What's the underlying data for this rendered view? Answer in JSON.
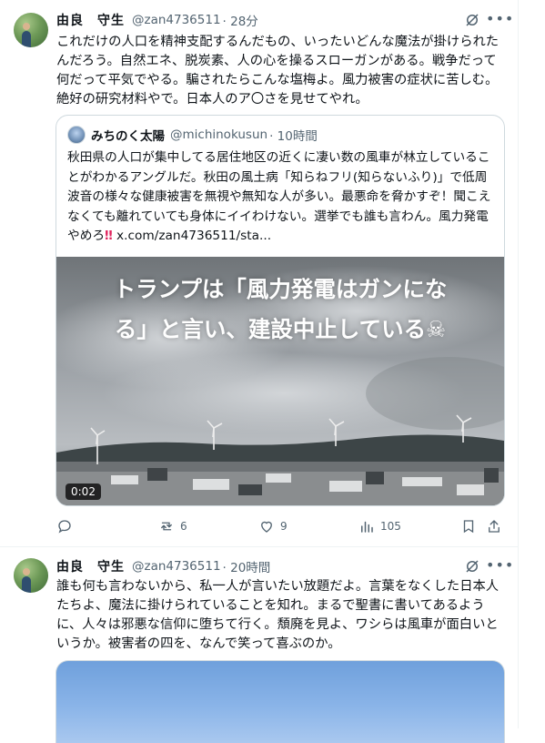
{
  "colors": {
    "text": "#0f1419",
    "secondary": "#536471",
    "border": "#cfd9de",
    "danger": "#e0245e"
  },
  "tweets": [
    {
      "author": "由良　守生",
      "handle": "@zan4736511",
      "time": "· 28分",
      "text": "これだけの人口を精神支配するんだもの、いったいどんな魔法が掛けられたんだろう。自然エネ、脱炭素、人の心を操るスローガンがある。戦争だって何だって平気でやる。騙されたらこんな塩梅よ。風力被害の症状に苦しむ。絶好の研究材料やで。日本人のア〇さを見せてやれ。",
      "quote": {
        "author": "みちのく太陽",
        "handle": "@michinokusun",
        "time": "· 10時間",
        "text": "秋田県の人口が集中してる居住地区の近くに凄い数の風車が林立していることがわかるアングルだ。秋田の風土病「知らねフリ(知らないふり)」で低周波音の様々な健康被害を無視や無知な人が多い。最悪命を脅かすぞ！聞こえなくても離れていても身体にイイわけない。選挙でも誰も言わん。風力発電やめろ",
        "bang": "‼",
        "link": "x.com/zan4736511/sta...",
        "overlay_line1": "トランプは「風力発電はガンにな",
        "overlay_line2": "る」と言い、建設中止している",
        "overlay_emoji": "☠",
        "duration": "0:02"
      },
      "actions": {
        "reply": "",
        "retweet": "6",
        "like": "9",
        "views": "105"
      }
    },
    {
      "author": "由良　守生",
      "handle": "@zan4736511",
      "time": "· 20時間",
      "text": "誰も何も言わないから、私一人が言いたい放題だよ。言葉をなくした日本人たちよ、魔法に掛けられていることを知れ。まるで聖書に書いてあるように、人々は邪悪な信仰に堕ちて行く。頽廃を見よ、ワシらは風車が面白いというか。被害者の四を、なんで笑って喜ぶのか。"
    }
  ]
}
